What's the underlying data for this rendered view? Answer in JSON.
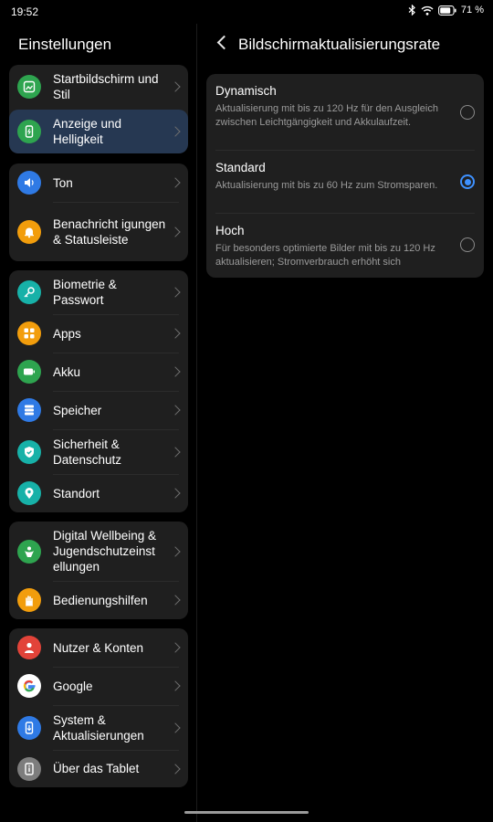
{
  "status": {
    "time": "19:52",
    "battery": "71 %"
  },
  "left": {
    "title": "Einstellungen",
    "groups": [
      {
        "items": [
          {
            "label": "Startbildschirm und Stil",
            "icon": "palette-icon",
            "color": "#2ea44f"
          },
          {
            "label": "Anzeige und Helligkeit",
            "icon": "display-icon",
            "color": "#2ea44f",
            "selected": true
          }
        ]
      },
      {
        "items": [
          {
            "label": "Ton",
            "icon": "speaker-icon",
            "color": "#2f7ae5"
          },
          {
            "label": "Benachricht igungen & Statusleiste",
            "icon": "bell-icon",
            "color": "#f29d0c"
          }
        ]
      },
      {
        "items": [
          {
            "label": "Biometrie & Passwort",
            "icon": "key-icon",
            "color": "#17b1a8"
          },
          {
            "label": "Apps",
            "icon": "apps-icon",
            "color": "#f29d0c"
          },
          {
            "label": "Akku",
            "icon": "battery-icon",
            "color": "#2ea44f"
          },
          {
            "label": "Speicher",
            "icon": "storage-icon",
            "color": "#2f7ae5"
          },
          {
            "label": "Sicherheit & Datenschutz",
            "icon": "shield-icon",
            "color": "#17b1a8"
          },
          {
            "label": "Standort",
            "icon": "location-icon",
            "color": "#17b1a8"
          }
        ]
      },
      {
        "items": [
          {
            "label": "Digital Wellbeing & Jugendschutzeinst ellungen",
            "icon": "wellbeing-icon",
            "color": "#2ea44f"
          },
          {
            "label": "Bedienungshilfen",
            "icon": "hand-icon",
            "color": "#f29d0c"
          }
        ]
      },
      {
        "items": [
          {
            "label": "Nutzer & Konten",
            "icon": "user-icon",
            "color": "#e24339"
          },
          {
            "label": "Google",
            "icon": "google-icon",
            "color": "#ffffff"
          },
          {
            "label": "System & Aktualisierungen",
            "icon": "system-update-icon",
            "color": "#2f7ae5"
          },
          {
            "label": "Über das Tablet",
            "icon": "tablet-info-icon",
            "color": "#7d7d7d"
          }
        ]
      }
    ]
  },
  "right": {
    "title": "Bildschirmaktualisierungsrate",
    "options": [
      {
        "title": "Dynamisch",
        "description": "Aktualisierung mit bis zu 120 Hz für den Ausgleich zwischen Leichtgängigkeit und Akkulaufzeit.",
        "selected": false
      },
      {
        "title": "Standard",
        "description": "Aktualisierung mit bis zu 60 Hz zum Stromsparen.",
        "selected": true
      },
      {
        "title": "Hoch",
        "description": "Für besonders optimierte Bilder mit bis zu 120 Hz aktualisieren; Stromverbrauch erhöht sich",
        "selected": false
      }
    ],
    "accent_color": "#3e91ff"
  }
}
